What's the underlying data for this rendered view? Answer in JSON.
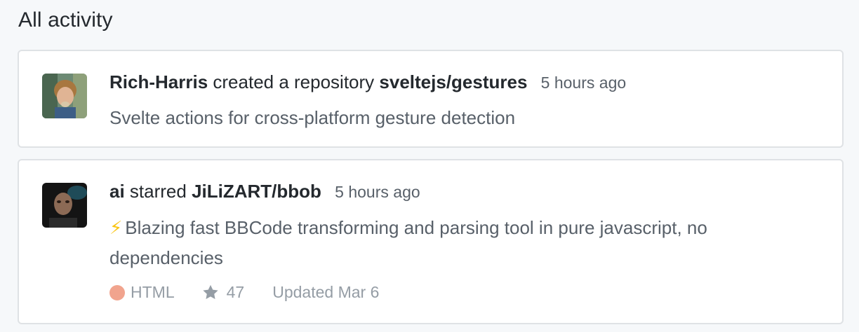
{
  "section": {
    "title": "All activity"
  },
  "events": [
    {
      "actor": "Rich-Harris",
      "action": "created a repository",
      "repo": "sveltejs/gestures",
      "time": "5 hours ago",
      "description": "Svelte actions for cross-platform gesture detection"
    },
    {
      "actor": "ai",
      "action": "starred",
      "repo": "JiLiZART/bbob",
      "time": "5 hours ago",
      "description_icon": "⚡",
      "description": "Blazing fast BBCode transforming and parsing tool in pure javascript, no dependencies",
      "language": "HTML",
      "language_color": "#f1a48e",
      "stars": "47",
      "updated": "Updated Mar 6"
    }
  ],
  "icons": {
    "star": "star-icon",
    "bolt": "lightning-icon"
  },
  "colors": {
    "link": "#24292e",
    "muted": "#586069",
    "meta": "#959da5",
    "border": "#dfe2e5"
  }
}
